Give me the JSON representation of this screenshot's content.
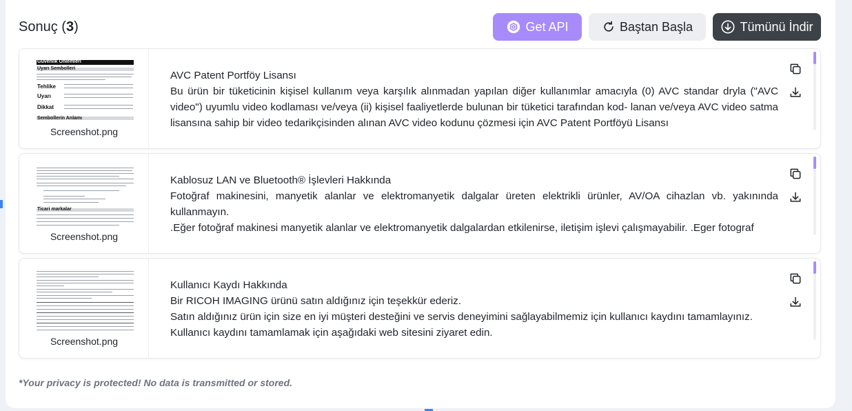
{
  "header": {
    "title_prefix": "Sonuç (",
    "count": "3",
    "title_suffix": ")",
    "api_label": "Get API",
    "restart_label": "Baştan Başla",
    "download_all_label": "Tümünü İndir"
  },
  "results": [
    {
      "filename": "Screenshot.png",
      "lines": [
        "AVC Patent Portföy Lisansı",
        "Bu ürün bir tüketicinin kişisel kullanım veya karşılık alınmadan yapılan diğer kullanımlar amacıyla (0) AVC standar dryla (\"AVC video\") uyumlu video kodlaması ve/veya (ii) kişisel faaliyetlerde bulunan bir tüketici tarafından kod- lanan ve/veya AVC video satma lisansına sahip bir video tedarikçisinden alınan AVC video kodunu çözmesi için AVC Patent Portföyü Lisansı"
      ],
      "thumb_labels": [
        "Güvenlik Önlemleri",
        "Uyarı Sembolleri",
        "Tehlike",
        "Uyarı",
        "Dikkat",
        "Sembollerin Anlamı"
      ]
    },
    {
      "filename": "Screenshot.png",
      "lines": [
        "Kablosuz LAN ve Bluetooth® İşlevleri Hakkında",
        "Fotoğraf makinesini, manyetik alanlar ve elektromanyetik dalgalar üreten elektrikli ürünler, AV/OA cihazlan vb. yakınında kullanmayın.",
        ".Eğer fotoğraf makinesi manyetik alanlar ve elektromanyetik dalgalardan etkilenirse, iletişim işlevi çalışmayabilir. .Eger fotograf"
      ],
      "thumb_labels": [
        "Ticari markalar"
      ]
    },
    {
      "filename": "Screenshot.png",
      "lines": [
        "Kullanıcı Kaydı Hakkında",
        "Bir RICOH IMAGING ürünü satın aldığınız için teşekkür ederiz.",
        "Satın aldığınız ürün için size en iyi müşteri desteğini ve servis deneyimini sağlayabilmemiz için kullanıcı kaydını tamamlayınız.",
        "Kullanıcı kaydını tamamlamak için aşağıdaki web sitesini ziyaret edin."
      ],
      "thumb_labels": []
    }
  ],
  "privacy_note": "*Your privacy is protected! No data is transmitted or stored.",
  "colors": {
    "accent": "#a78bfa",
    "dark_button": "#3c4247",
    "light_button": "#eceef1"
  },
  "icons": {
    "api": "openai-logo-icon",
    "restart": "restart-arrow-icon",
    "download_all": "download-circle-icon",
    "copy": "copy-icon",
    "download": "download-icon"
  }
}
